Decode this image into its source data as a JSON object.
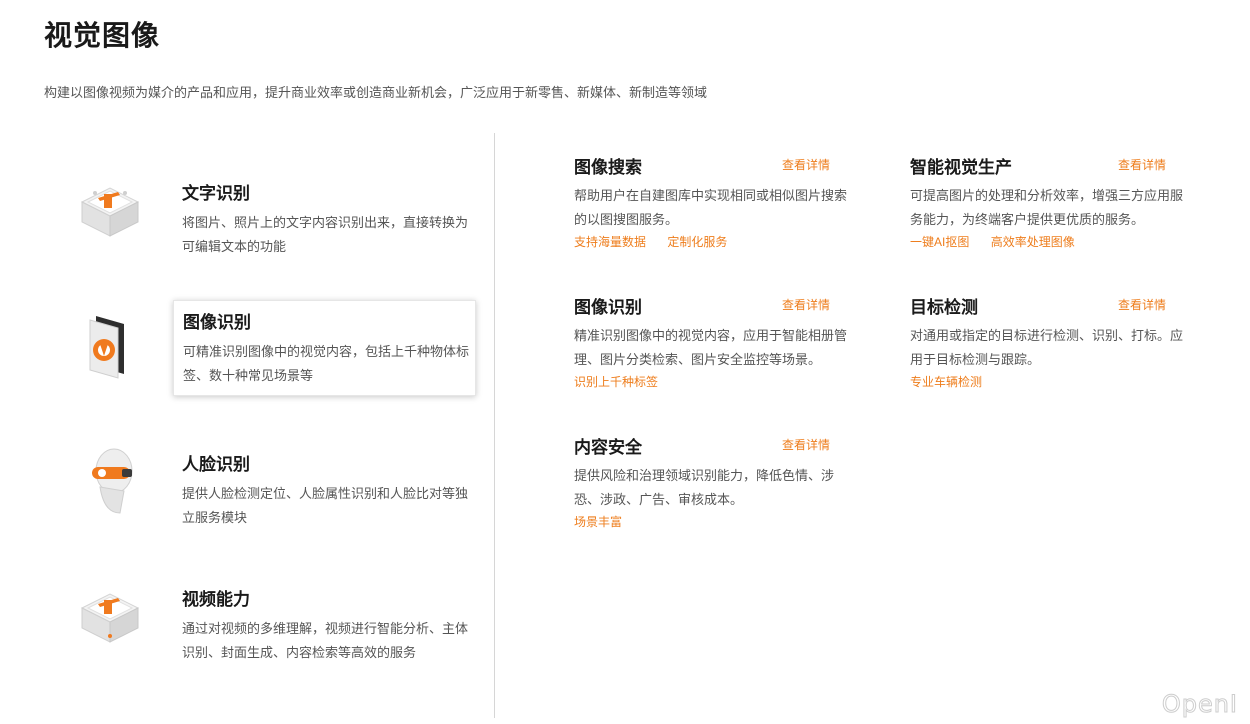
{
  "header": {
    "title": "视觉图像",
    "description": "构建以图像视频为媒介的产品和应用，提升商业效率或创造商业新机会，广泛应用于新零售、新媒体、新制造等领域"
  },
  "categories": [
    {
      "title": "文字识别",
      "desc": "将图片、照片上的文字内容识别出来，直接转换为可编辑文本的功能",
      "icon": "cube-text-icon"
    },
    {
      "title": "图像识别",
      "desc": "可精准识别图像中的视觉内容，包括上千种物体标签、数十种常见场景等",
      "icon": "image-scan-icon"
    },
    {
      "title": "人脸识别",
      "desc": "提供人脸检测定位、人脸属性识别和人脸比对等独立服务模块",
      "icon": "face-head-icon"
    },
    {
      "title": "视频能力",
      "desc": "通过对视频的多维理解，视频进行智能分析、主体识别、封面生成、内容检索等高效的服务",
      "icon": "cube-video-icon"
    }
  ],
  "products": [
    {
      "title": "图像搜索",
      "more": "查看详情",
      "desc": "帮助用户在自建图库中实现相同或相似图片搜索的以图搜图服务。",
      "tags": [
        "支持海量数据",
        "定制化服务"
      ]
    },
    {
      "title": "智能视觉生产",
      "more": "查看详情",
      "desc": "可提高图片的处理和分析效率，增强三方应用服务能力，为终端客户提供更优质的服务。",
      "tags": [
        "一键AI抠图",
        "高效率处理图像"
      ]
    },
    {
      "title": "图像识别",
      "more": "查看详情",
      "desc": "精准识别图像中的视觉内容，应用于智能相册管理、图片分类检索、图片安全监控等场景。",
      "tags": [
        "识别上千种标签"
      ]
    },
    {
      "title": "目标检测",
      "more": "查看详情",
      "desc": "对通用或指定的目标进行检测、识别、打标。应用于目标检测与跟踪。",
      "tags": [
        "专业车辆检测"
      ]
    },
    {
      "title": "内容安全",
      "more": "查看详情",
      "desc": "提供风险和治理领域识别能力，降低色情、涉恐、涉政、广告、审核成本。",
      "tags": [
        "场景丰富"
      ]
    }
  ],
  "watermark": "OpenI",
  "colors": {
    "accent": "#ee7d1c",
    "title": "#1a1a1a",
    "text": "#555555"
  }
}
